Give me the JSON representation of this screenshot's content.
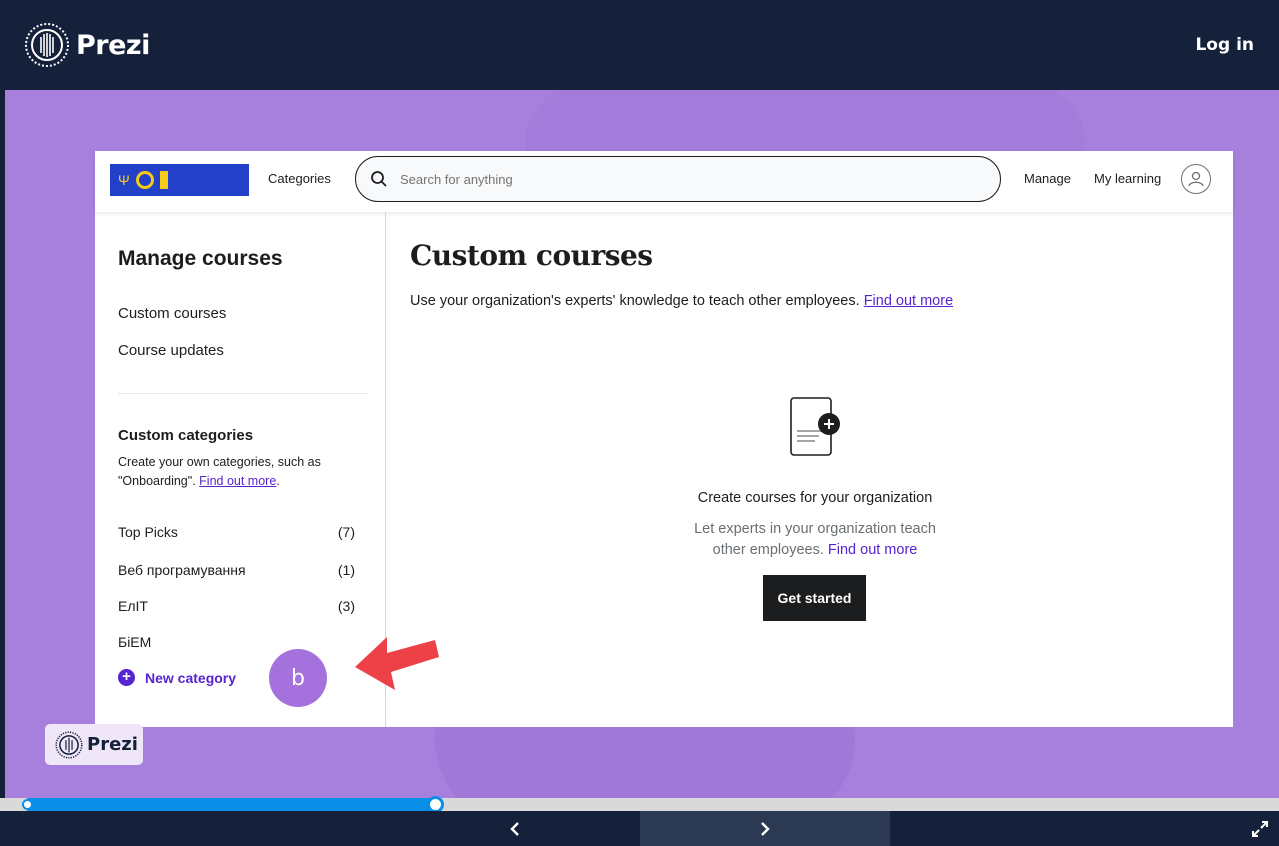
{
  "topbar": {
    "brand": "Prezi",
    "login": "Log in"
  },
  "app": {
    "header": {
      "categories": "Categories",
      "search_placeholder": "Search for anything",
      "manage": "Manage",
      "my_learning": "My learning"
    },
    "sidebar": {
      "title": "Manage courses",
      "links": [
        "Custom courses",
        "Course updates"
      ],
      "custom_categories_title": "Custom categories",
      "custom_categories_desc": "Create your own categories, such as \"Onboarding\".",
      "custom_categories_link": "Find out more",
      "categories": [
        {
          "name": "Top Picks",
          "count": "(7)"
        },
        {
          "name": "Веб програмування",
          "count": "(1)"
        },
        {
          "name": "ЕлІТ",
          "count": "(3)"
        },
        {
          "name": "БіЕМ",
          "count": ""
        }
      ],
      "new_category": "New category"
    },
    "main": {
      "title": "Custom courses",
      "subtitle": "Use your organization's experts' knowledge to teach other employees.",
      "subtitle_link": "Find out more",
      "empty_title": "Create courses for your organization",
      "empty_desc_line1": "Let experts in your organization teach",
      "empty_desc_line2": "other employees.",
      "empty_desc_link": "Find out more",
      "cta": "Get started"
    }
  },
  "cursor_letter": "b",
  "badge": "Prezi",
  "progress": {
    "fraction": 0.34
  },
  "colors": {
    "accent": "#5624d0",
    "stage": "#a77fdd",
    "progress": "#0a8fe8",
    "dark": "#15213a"
  }
}
